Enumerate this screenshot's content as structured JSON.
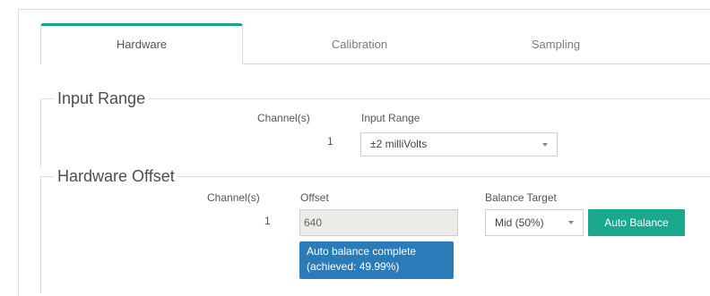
{
  "tabs": [
    {
      "label": "Hardware",
      "active": true
    },
    {
      "label": "Calibration",
      "active": false
    },
    {
      "label": "Sampling",
      "active": false
    }
  ],
  "input_range": {
    "legend": "Input Range",
    "channel_header": "Channel(s)",
    "range_header": "Input Range",
    "channel": "1",
    "selected_range": "±2 milliVolts"
  },
  "hardware_offset": {
    "legend": "Hardware Offset",
    "channel_header": "Channel(s)",
    "offset_header": "Offset",
    "balance_header": "Balance Target",
    "channel": "1",
    "offset_value": "640",
    "balance_target": "Mid (50%)",
    "auto_balance_label": "Auto Balance",
    "status_line1": "Auto balance complete",
    "status_line2": "(achieved: 49.99%)"
  },
  "colors": {
    "accent": "#1aa88e",
    "tooltip": "#2b7bb9",
    "readonly_field": "#ecebe8"
  }
}
